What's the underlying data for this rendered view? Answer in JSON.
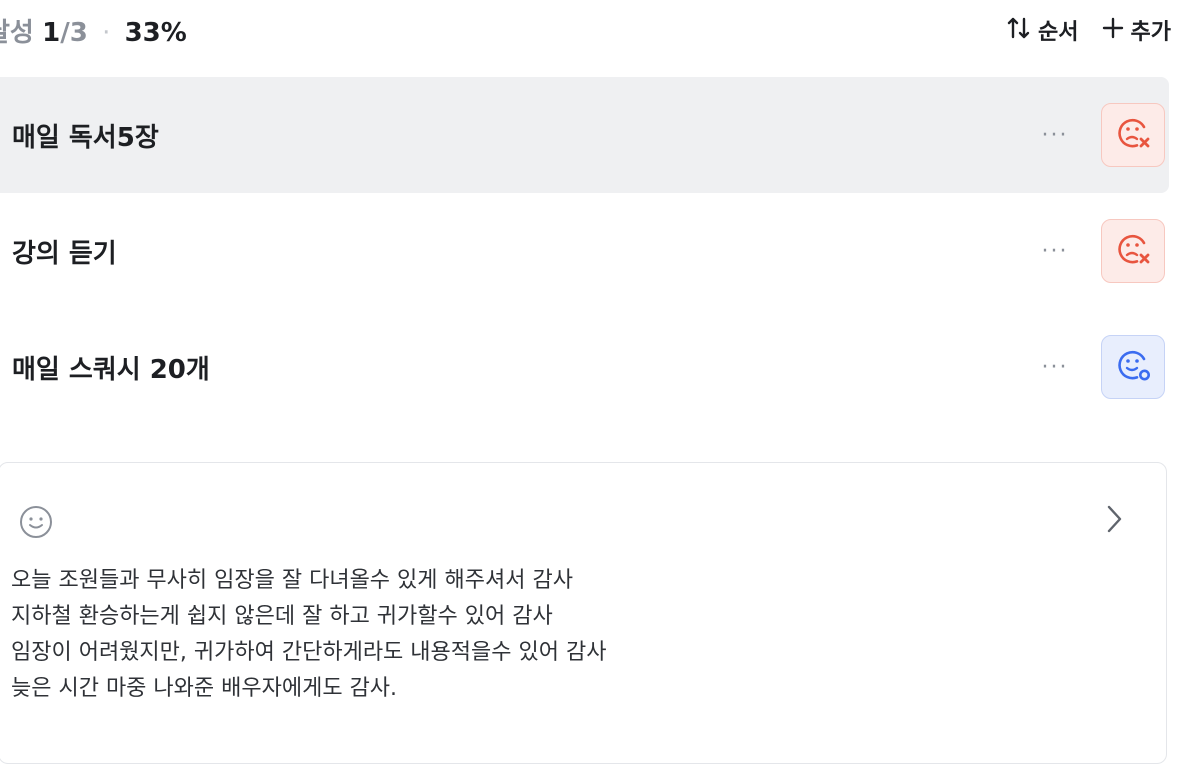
{
  "header": {
    "label": "달성",
    "done": "1",
    "slash_total": "/3",
    "dot": "·",
    "percent": "33%",
    "sort_icon": "up-down-arrows-icon",
    "sort_label": "순서",
    "add_icon": "plus-icon",
    "add_label": "추가"
  },
  "habits": [
    {
      "title": "매일 독서5장",
      "more": "···",
      "status": "fail",
      "status_icon": "sad-face-x-icon"
    },
    {
      "title": "강의 듣기",
      "more": "···",
      "status": "fail",
      "status_icon": "sad-face-x-icon"
    },
    {
      "title": "매일 스쿼시 20개",
      "more": "···",
      "status": "success",
      "status_icon": "smile-face-o-icon"
    }
  ],
  "note": {
    "mood_icon": "smile-icon",
    "chevron_icon": "chevron-right-icon",
    "lines": [
      "오늘 조원들과 무사히 임장을 잘 다녀올수 있게 해주셔서 감사",
      "지하철 환승하는게 쉽지 않은데 잘 하고 귀가할수 있어 감사",
      "임장이 어려웠지만, 귀가하여 간단하게라도 내용적을수 있어 감사",
      "늦은 시간 마중 나와준 배우자에게도 감사."
    ]
  },
  "colors": {
    "fail": "#e8553f",
    "success": "#3b6cf0",
    "selected_row": "#eff0f2"
  }
}
